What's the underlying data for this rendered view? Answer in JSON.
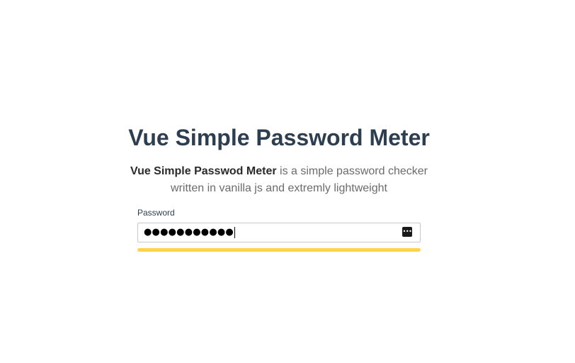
{
  "header": {
    "title": "Vue Simple Password Meter"
  },
  "description": {
    "strong": "Vue Simple Passwod Meter",
    "rest": " is a simple password checker written in vanilla js and extremly lightweight"
  },
  "password_field": {
    "label": "Password",
    "masked_value": "●●●●●●●●●●●",
    "input_type": "password",
    "icon": "password-manager-key-icon"
  },
  "strength_meter": {
    "fill_fraction": 1.0,
    "color": "#fdd34a"
  }
}
